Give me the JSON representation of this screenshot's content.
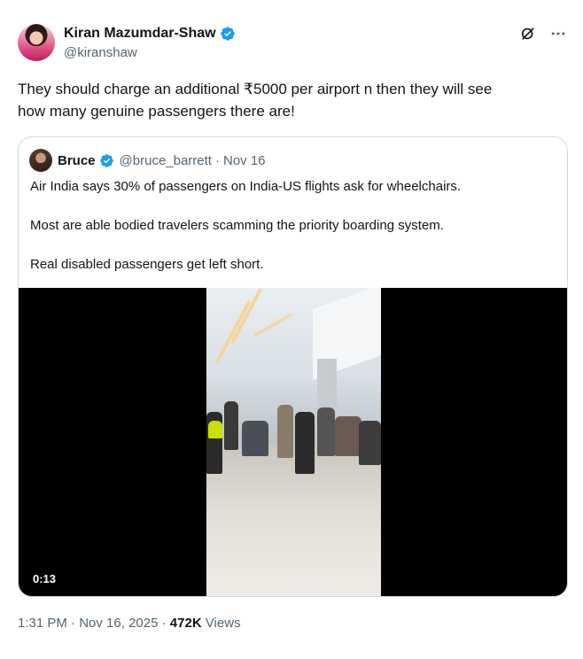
{
  "author": {
    "name": "Kiran Mazumdar-Shaw",
    "handle": "@kiranshaw"
  },
  "tweet": {
    "text_line1": "They should charge an additional ₹5000 per airport n then they will see",
    "text_line2": "how many genuine passengers there are!"
  },
  "quote": {
    "name": "Bruce",
    "handle": "@bruce_barrett",
    "separator": "·",
    "date": "Nov 16",
    "paragraphs": [
      "Air India says 30% of passengers on India-US flights ask for wheelchairs.",
      "Most are able bodied travelers scamming the priority boarding system.",
      "Real disabled passengers get left short."
    ],
    "video_duration": "0:13"
  },
  "footer": {
    "time": "1:31 PM",
    "sep1": "·",
    "date": "Nov 16, 2025",
    "sep2": "·",
    "views_count": "472K",
    "views_label": "Views"
  },
  "colors": {
    "verified": "#1d9bf0",
    "secondary_text": "#536471",
    "border": "#cfd9de"
  },
  "icons": {
    "verified": "verified-badge-icon",
    "grok": "grok-icon",
    "more": "more-icon"
  }
}
